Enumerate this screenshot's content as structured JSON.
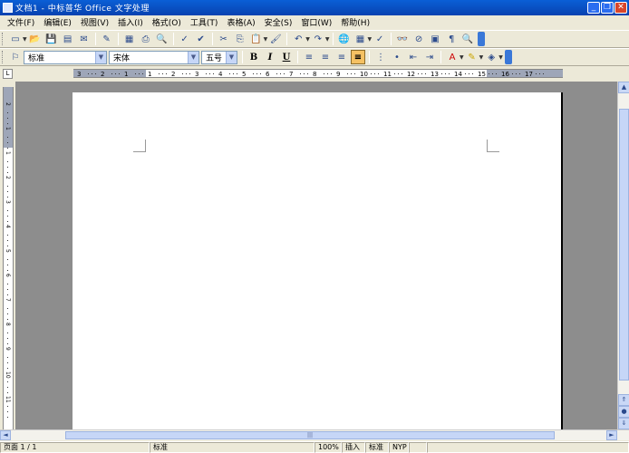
{
  "window": {
    "title": "文档1 - 中标普华 Office 文字处理",
    "minimize": "_",
    "restore": "❐",
    "close": "✕"
  },
  "menu": [
    "文件(F)",
    "编辑(E)",
    "视图(V)",
    "插入(I)",
    "格式(O)",
    "工具(T)",
    "表格(A)",
    "安全(S)",
    "窗口(W)",
    "帮助(H)"
  ],
  "toolbar_standard": {
    "icons": [
      "new-icon",
      "open-icon",
      "save-icon",
      "permission-icon",
      "email-icon",
      "edit-icon",
      "export-pdf-icon",
      "print-icon",
      "print-preview-icon",
      "spellcheck-icon",
      "autocheck-icon",
      "cut-icon",
      "copy-icon",
      "paste-icon",
      "format-painter-icon",
      "undo-icon",
      "redo-icon",
      "hyperlink-icon",
      "table-icon",
      "draw-icon",
      "find-icon",
      "navigator-icon",
      "gallery-icon",
      "pilcrow-icon",
      "zoom-icon"
    ]
  },
  "toolbar_format": {
    "style_value": "标准",
    "font_value": "宋体",
    "size_value": "五号",
    "bold": "B",
    "italic": "I",
    "underline": "U"
  },
  "ruler": {
    "labels": [
      "3",
      "2",
      "1",
      "1",
      "2",
      "3",
      "4",
      "5",
      "6",
      "7",
      "8",
      "9",
      "10",
      "11",
      "12",
      "13",
      "14",
      "15",
      "16",
      "17"
    ],
    "vertical_labels": [
      "2",
      "1",
      "1",
      "2",
      "3",
      "4",
      "5",
      "6",
      "7",
      "8",
      "9",
      "10",
      "11"
    ]
  },
  "statusbar": {
    "page": "页面 1 / 1",
    "style": "标准",
    "zoom": "100%",
    "mode": "插入",
    "selection": "标准",
    "language": "NYP"
  }
}
